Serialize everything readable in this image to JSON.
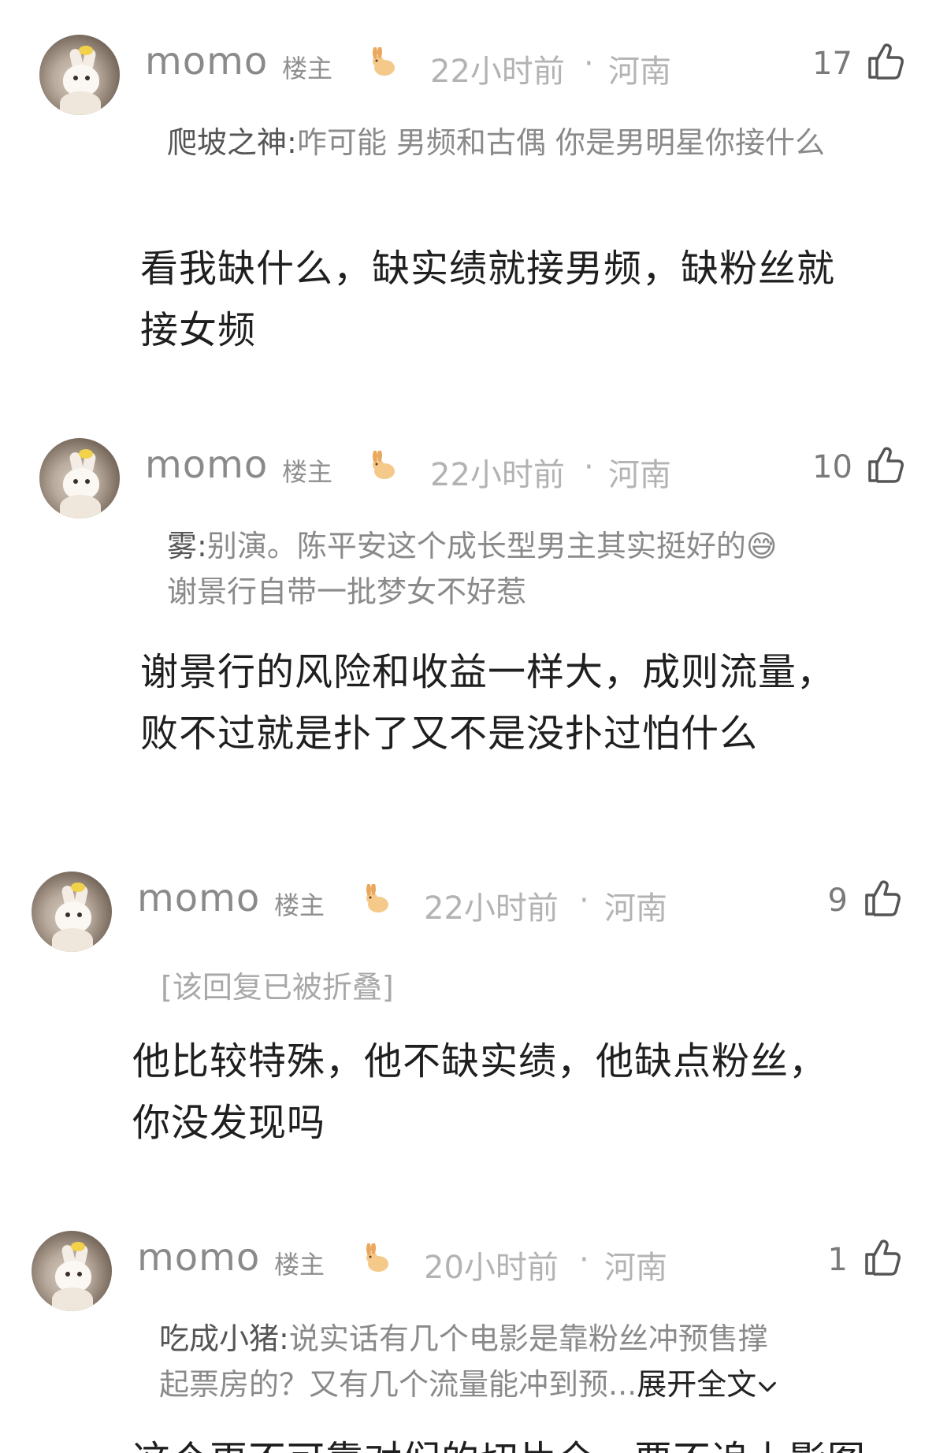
{
  "comments": [
    {
      "username": "momo",
      "op_label": "楼主",
      "time": "22小时前",
      "separator": "·",
      "location": "河南",
      "likes": "17",
      "quote_author": "爬坡之神:",
      "quote_text": "咋可能 男频和古偶 你是男明星你接什么",
      "reply_line1": "看我缺什么，缺实绩就接男频，缺粉丝就",
      "reply_line2": "接女频"
    },
    {
      "username": "momo",
      "op_label": "楼主",
      "time": "22小时前",
      "separator": "·",
      "location": "河南",
      "likes": "10",
      "quote_author": "雾:",
      "quote_line1": "别演。陈平安这个成长型男主其实挺好的😅",
      "quote_line2": "谢景行自带一批梦女不好惹",
      "reply_line1": "谢景行的风险和收益一样大，成则流量，",
      "reply_line2": "败不过就是扑了又不是没扑过怕什么"
    },
    {
      "username": "momo",
      "op_label": "楼主",
      "time": "22小时前",
      "separator": "·",
      "location": "河南",
      "likes": "9",
      "folded_text": "[该回复已被折叠]",
      "reply_line1": "他比较特殊，他不缺实绩，他缺点粉丝，",
      "reply_line2": "你没发现吗"
    },
    {
      "username": "momo",
      "op_label": "楼主",
      "time": "20小时前",
      "separator": "·",
      "location": "河南",
      "likes": "1",
      "quote_author": "吃成小猪:",
      "quote_line1": "说实话有几个电影是靠粉丝冲预售撑",
      "quote_line2": "起票房的？又有几个流量能冲到预...",
      "expand_label": "展开全文",
      "expand_icon": "chevron-down-icon",
      "reply_partial": "这个更不可靠对们的切片全一要不追上影图"
    }
  ],
  "icons": {
    "avatar": "rabbit-avatar",
    "badge": "rabbit-icon",
    "like": "thumbs-up-icon"
  }
}
